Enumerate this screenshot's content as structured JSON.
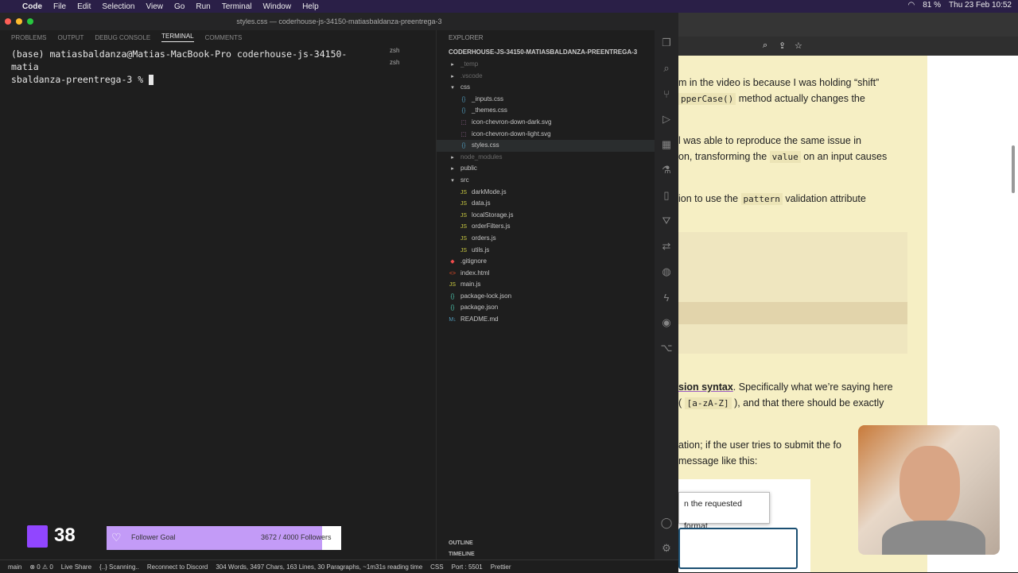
{
  "menubar": {
    "app": "Code",
    "items": [
      "File",
      "Edit",
      "Selection",
      "View",
      "Go",
      "Run",
      "Terminal",
      "Window",
      "Help"
    ],
    "battery": "81 %",
    "clock": "Thu 23 Feb 10:52"
  },
  "window": {
    "title": "styles.css — coderhouse-js-34150-matiasbaldanza-preentrega-3"
  },
  "panel": {
    "tabs": [
      "PROBLEMS",
      "OUTPUT",
      "DEBUG CONSOLE",
      "TERMINAL",
      "COMMENTS"
    ],
    "active_tab": "TERMINAL",
    "terminal_line1": "(base) matiasbaldanza@Matias-MacBook-Pro coderhouse-js-34150-matia",
    "terminal_line2": "sbaldanza-preentrega-3 % ",
    "shells": [
      "zsh",
      "zsh"
    ]
  },
  "explorer": {
    "header": "EXPLORER",
    "project": "CODERHOUSE-JS-34150-MATIASBALDANZA-PREENTREGA-3",
    "tree": [
      {
        "name": "_temp",
        "kind": "folder-closed",
        "depth": 1,
        "dim": true
      },
      {
        "name": ".vscode",
        "kind": "folder-closed",
        "depth": 1,
        "dim": true
      },
      {
        "name": "css",
        "kind": "folder-open",
        "depth": 1
      },
      {
        "name": "_inputs.css",
        "kind": "css",
        "depth": 2
      },
      {
        "name": "_themes.css",
        "kind": "css",
        "depth": 2
      },
      {
        "name": "icon-chevron-down-dark.svg",
        "kind": "svg",
        "depth": 2
      },
      {
        "name": "icon-chevron-down-light.svg",
        "kind": "svg",
        "depth": 2
      },
      {
        "name": "styles.css",
        "kind": "css",
        "depth": 2,
        "selected": true
      },
      {
        "name": "node_modules",
        "kind": "folder-closed",
        "depth": 1,
        "dim": true
      },
      {
        "name": "public",
        "kind": "folder-closed",
        "depth": 1
      },
      {
        "name": "src",
        "kind": "folder-open",
        "depth": 1
      },
      {
        "name": "darkMode.js",
        "kind": "js",
        "depth": 2
      },
      {
        "name": "data.js",
        "kind": "js",
        "depth": 2
      },
      {
        "name": "localStorage.js",
        "kind": "js",
        "depth": 2
      },
      {
        "name": "orderFilters.js",
        "kind": "js",
        "depth": 2
      },
      {
        "name": "orders.js",
        "kind": "js",
        "depth": 2
      },
      {
        "name": "utils.js",
        "kind": "js",
        "depth": 2
      },
      {
        "name": ".gitignore",
        "kind": "git",
        "depth": 1
      },
      {
        "name": "index.html",
        "kind": "html",
        "depth": 1
      },
      {
        "name": "main.js",
        "kind": "js",
        "depth": 1
      },
      {
        "name": "package-lock.json",
        "kind": "json",
        "depth": 1
      },
      {
        "name": "package.json",
        "kind": "json",
        "depth": 1
      },
      {
        "name": "README.md",
        "kind": "md",
        "depth": 1
      }
    ],
    "outline": "OUTLINE",
    "timeline": "TIMELINE"
  },
  "statusbar": {
    "branch": "main",
    "problems": "⊗ 0 ⚠ 0",
    "liveshare": "Live Share",
    "scanning": "{..} Scanning..",
    "discord": "Reconnect to Discord",
    "stats": "304 Words, 3497 Chars, 163 Lines, 30 Paragraphs, ~1m31s reading time",
    "lang": "CSS",
    "port": "Port : 5501",
    "prettier": "Prettier"
  },
  "article": {
    "p1a": "m in the video is because I was holding “shift”",
    "p1b_code": "pperCase()",
    "p1b_text": " method actually changes the",
    "p2a": "l was able to reproduce the same issue in",
    "p2b_text1": "on, transforming the ",
    "p2b_code": "value",
    "p2b_text2": " on an input causes",
    "p3_text1": "ion to use the ",
    "p3_code": "pattern",
    "p3_text2": " validation attribute",
    "p4_link": "sion syntax",
    "p4_text": ". Specifically what we’re saying here",
    "p4b_text1": "( ",
    "p4b_code": "[a-zA-Z]",
    "p4b_text2": " ), and that there should be exactly",
    "p5a": "ation; if the user tries to submit the fo",
    "p5b": "message like this:",
    "tooltip": "n the requested format."
  },
  "twitch": {
    "follower_count": "38",
    "goal_label": "Follower Goal",
    "goal_value": "3672 / 4000 Followers",
    "goal_progress": 0.918
  },
  "colors": {
    "twitch_purple": "#9146ff",
    "goal_fill": "#c39bf7",
    "article_bg": "#f6efc4"
  }
}
